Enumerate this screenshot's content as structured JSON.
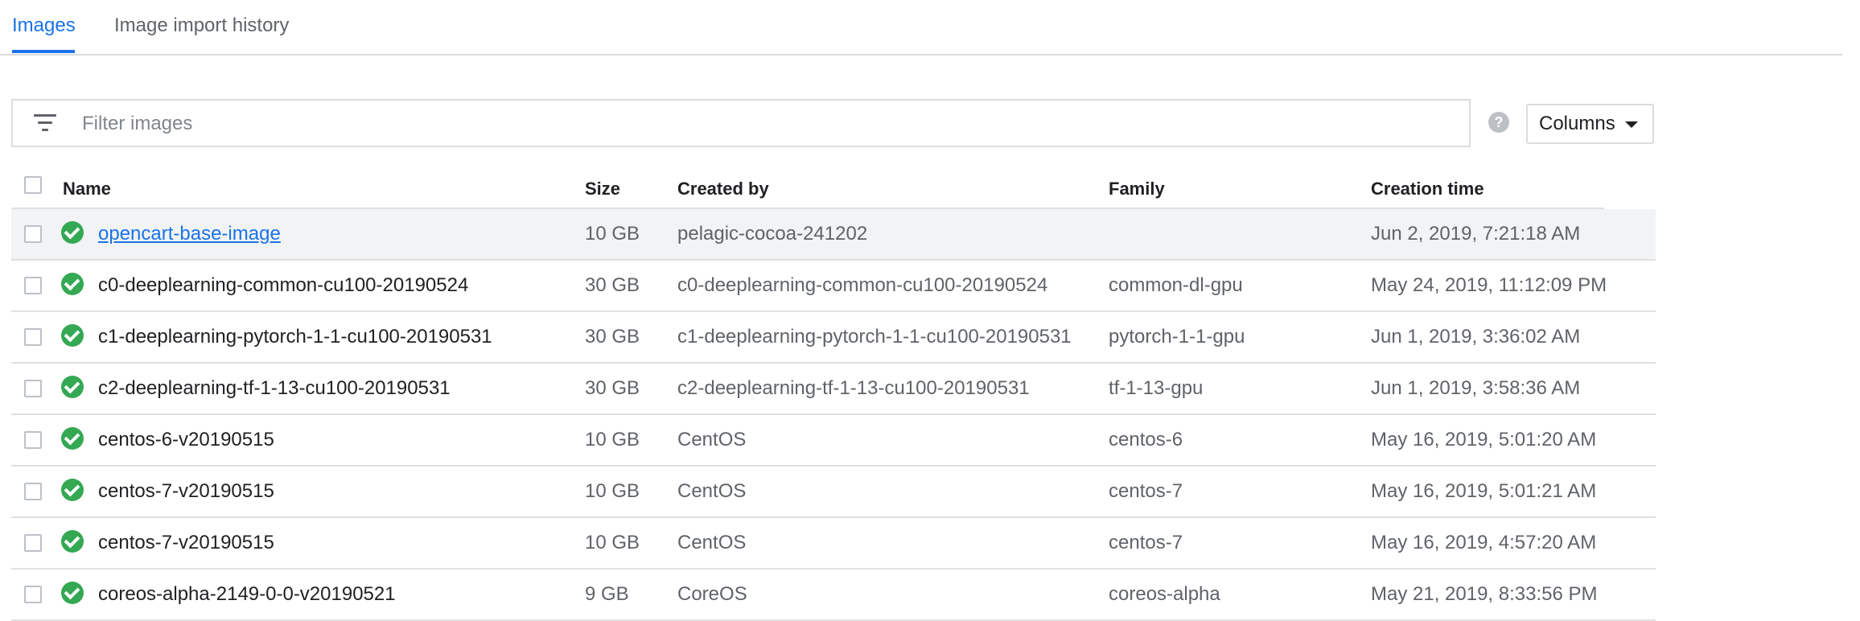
{
  "tabs": [
    {
      "label": "Images",
      "active": true
    },
    {
      "label": "Image import history",
      "active": false
    }
  ],
  "filter": {
    "placeholder": "Filter images",
    "value": ""
  },
  "help_icon_glyph": "?",
  "columns_button": {
    "label": "Columns"
  },
  "table": {
    "headers": {
      "name": "Name",
      "size": "Size",
      "created_by": "Created by",
      "family": "Family",
      "creation_time": "Creation time"
    },
    "rows": [
      {
        "name": "opencart-base-image",
        "size": "10 GB",
        "created_by": "pelagic-cocoa-241202",
        "family": "",
        "creation_time": "Jun 2, 2019, 7:21:18 AM",
        "status": "ready"
      },
      {
        "name": "c0-deeplearning-common-cu100-20190524",
        "size": "30 GB",
        "created_by": "c0-deeplearning-common-cu100-20190524",
        "family": "common-dl-gpu",
        "creation_time": "May 24, 2019, 11:12:09 PM",
        "status": "ready"
      },
      {
        "name": "c1-deeplearning-pytorch-1-1-cu100-20190531",
        "size": "30 GB",
        "created_by": "c1-deeplearning-pytorch-1-1-cu100-20190531",
        "family": "pytorch-1-1-gpu",
        "creation_time": "Jun 1, 2019, 3:36:02 AM",
        "status": "ready"
      },
      {
        "name": "c2-deeplearning-tf-1-13-cu100-20190531",
        "size": "30 GB",
        "created_by": "c2-deeplearning-tf-1-13-cu100-20190531",
        "family": "tf-1-13-gpu",
        "creation_time": "Jun 1, 2019, 3:58:36 AM",
        "status": "ready"
      },
      {
        "name": "centos-6-v20190515",
        "size": "10 GB",
        "created_by": "CentOS",
        "family": "centos-6",
        "creation_time": "May 16, 2019, 5:01:20 AM",
        "status": "ready"
      },
      {
        "name": "centos-7-v20190515",
        "size": "10 GB",
        "created_by": "CentOS",
        "family": "centos-7",
        "creation_time": "May 16, 2019, 5:01:21 AM",
        "status": "ready"
      },
      {
        "name": "centos-7-v20190515",
        "size": "10 GB",
        "created_by": "CentOS",
        "family": "centos-7",
        "creation_time": "May 16, 2019, 4:57:20 AM",
        "status": "ready"
      },
      {
        "name": "coreos-alpha-2149-0-0-v20190521",
        "size": "9 GB",
        "created_by": "CoreOS",
        "family": "coreos-alpha",
        "creation_time": "May 21, 2019, 8:33:56 PM",
        "status": "ready"
      }
    ]
  },
  "colors": {
    "accent": "#1a73e8",
    "status_ready": "#34a853",
    "highlight_row": "#f1f3f4"
  }
}
